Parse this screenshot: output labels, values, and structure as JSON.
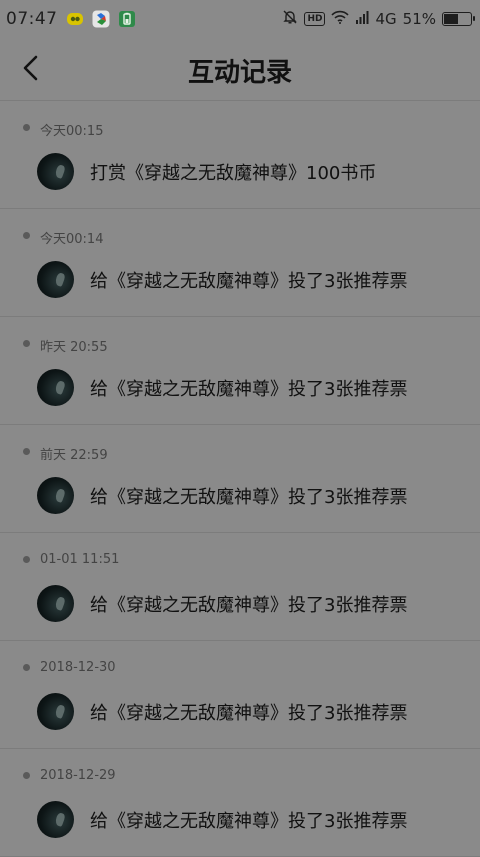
{
  "status_bar": {
    "time": "07:47",
    "network": "4G",
    "battery_percent": "51%",
    "battery_level": 0.51,
    "icons": [
      "yellow-app-icon",
      "colorful-app-icon",
      "green-battery-app-icon",
      "mute-bell-icon",
      "hd-icon",
      "wifi-icon",
      "signal-icon",
      "battery-icon"
    ],
    "hd_label": "HD"
  },
  "header": {
    "title": "互动记录",
    "back_icon": "chevron-left-icon"
  },
  "records": [
    {
      "time": "今天00:15",
      "text": "打赏《穿越之无敌魔神尊》100书币"
    },
    {
      "time": "今天00:14",
      "text": "给《穿越之无敌魔神尊》投了3张推荐票"
    },
    {
      "time": "昨天 20:55",
      "text": "给《穿越之无敌魔神尊》投了3张推荐票"
    },
    {
      "time": "前天 22:59",
      "text": "给《穿越之无敌魔神尊》投了3张推荐票"
    },
    {
      "time": "01-01 11:51",
      "text": "给《穿越之无敌魔神尊》投了3张推荐票"
    },
    {
      "time": "2018-12-30",
      "text": "给《穿越之无敌魔神尊》投了3张推荐票"
    },
    {
      "time": "2018-12-29",
      "text": "给《穿越之无敌魔神尊》投了3张推荐票"
    }
  ]
}
